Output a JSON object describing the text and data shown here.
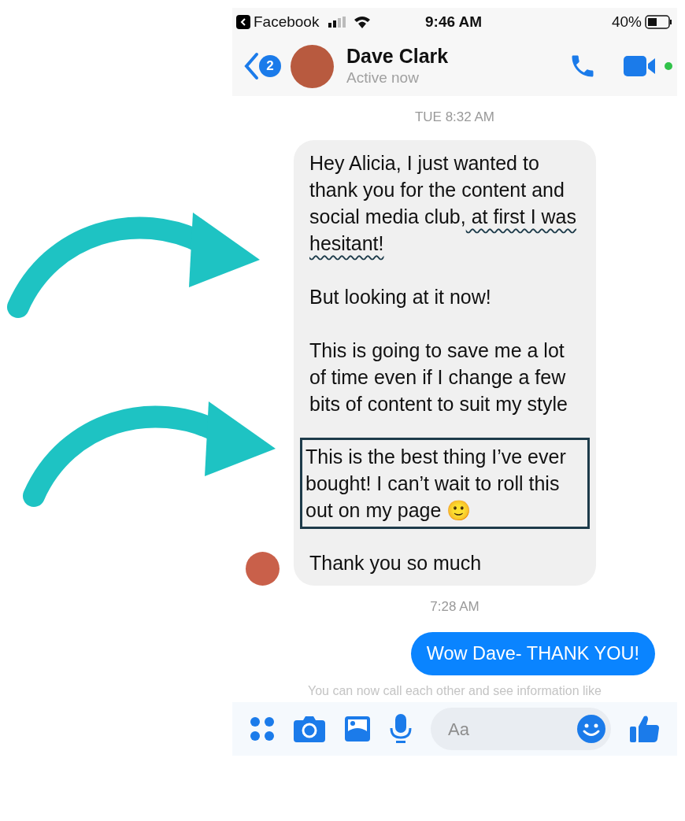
{
  "status_bar": {
    "back_app": "Facebook",
    "time": "9:46 AM",
    "battery": "40%"
  },
  "header": {
    "back_badge": "2",
    "name": "Dave Clark",
    "status": "Active now"
  },
  "messages": [
    {
      "kind": "timestamp",
      "text": "TUE 8:32 AM"
    },
    {
      "kind": "received",
      "paragraphs": [
        {
          "boxed": false,
          "segments": [
            {
              "text": "Hey Alicia, I just wanted to thank you for the content and social media club,",
              "underlined": false
            },
            {
              "text": " at first I was hesitant!",
              "underlined": true
            }
          ]
        },
        {
          "boxed": false,
          "segments": [
            {
              "text": "But looking at it now!",
              "underlined": false
            }
          ]
        },
        {
          "boxed": false,
          "segments": [
            {
              "text": "This is going to save me a lot of time even if I change a few bits of content to suit my style",
              "underlined": false
            }
          ]
        },
        {
          "boxed": true,
          "segments": [
            {
              "text": "This is the best thing I’ve ever bought! I can’t wait to roll this out on my page 🙂",
              "underlined": false
            }
          ]
        },
        {
          "boxed": false,
          "segments": [
            {
              "text": "Thank you so much",
              "underlined": false
            }
          ]
        }
      ]
    },
    {
      "kind": "timestamp",
      "text": "7:28 AM"
    },
    {
      "kind": "sent",
      "text": "Wow Dave- THANK YOU!"
    },
    {
      "kind": "notice",
      "text": "You can now call each other and see information like"
    }
  ],
  "composer": {
    "placeholder": "Aa"
  }
}
